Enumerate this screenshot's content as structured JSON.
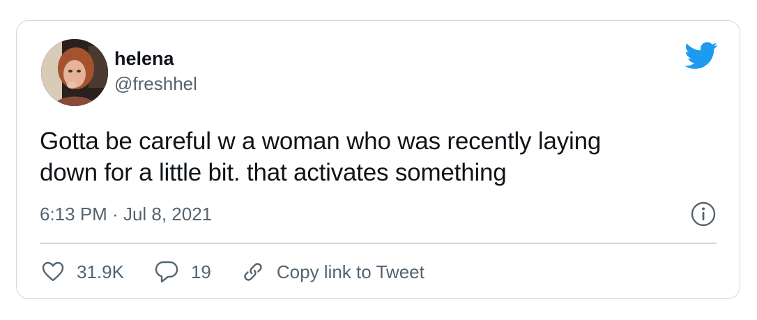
{
  "tweet": {
    "display_name": "helena",
    "handle": "@freshhel",
    "text_line1": "Gotta be careful w a woman who was recently laying",
    "text_line2": "down for a little bit. that activates something",
    "time": "6:13 PM",
    "separator": " · ",
    "date": "Jul 8, 2021"
  },
  "actions": {
    "likes": "31.9K",
    "replies": "19",
    "copy_link": "Copy link to Tweet"
  },
  "icons": {
    "brand": "twitter-bird-icon",
    "info": "info-icon",
    "like": "heart-icon",
    "reply": "speech-bubble-icon",
    "link": "link-icon"
  },
  "colors": {
    "brand_blue": "#1d9bf0",
    "text": "#0f1419",
    "muted": "#536471",
    "border": "#cfd9de"
  }
}
